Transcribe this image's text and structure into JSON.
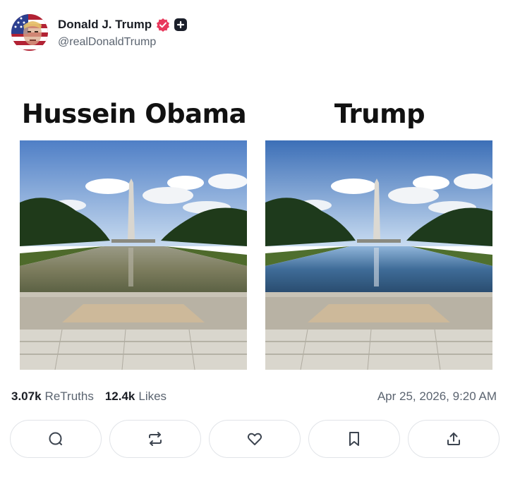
{
  "post": {
    "author": {
      "display_name": "Donald J. Trump",
      "handle": "@realDonaldTrump",
      "badges": [
        "verified-icon",
        "plus-icon"
      ]
    },
    "image": {
      "panels": [
        {
          "title": "Hussein Obama",
          "water": "murky-green"
        },
        {
          "title": "Trump",
          "water": "clear-blue"
        }
      ]
    },
    "stats": {
      "retruths_count": "3.07k",
      "retruths_label": "ReTruths",
      "likes_count": "12.4k",
      "likes_label": "Likes"
    },
    "timestamp": "Apr 25, 2026, 9:20 AM",
    "actions": [
      "reply-icon",
      "retruth-icon",
      "like-icon",
      "bookmark-icon",
      "share-icon"
    ]
  },
  "colors": {
    "verified": "#e8385c",
    "muted_text": "#5b6470",
    "button_border": "#e1e4e8"
  }
}
